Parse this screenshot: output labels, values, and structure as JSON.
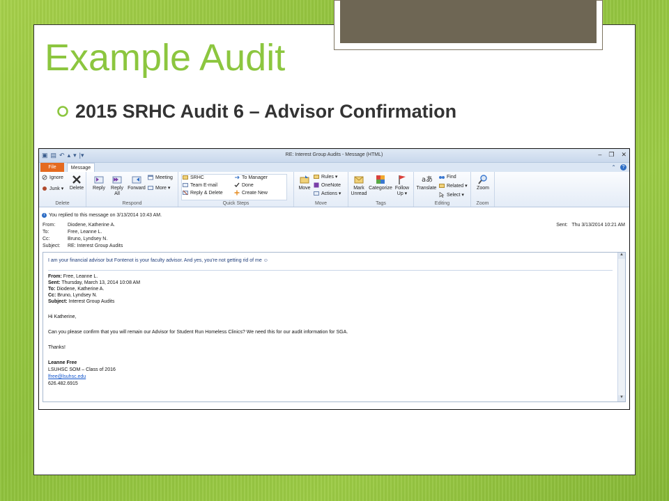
{
  "slide": {
    "title": "Example Audit",
    "bullet": "2015 SRHC Audit 6 – Advisor Confirmation"
  },
  "window": {
    "title": "RE: Interest Group Audits  -  Message (HTML)",
    "tabs": {
      "file": "File",
      "message": "Message"
    }
  },
  "ribbon": {
    "delete_group": {
      "label": "Delete",
      "ignore": "Ignore",
      "junk": "Junk ▾",
      "delete": "Delete"
    },
    "respond_group": {
      "label": "Respond",
      "reply": "Reply",
      "reply_all_1": "Reply",
      "reply_all_2": "All",
      "forward": "Forward",
      "meeting": "Meeting",
      "more": "More ▾"
    },
    "quick_steps": {
      "label": "Quick Steps",
      "items": [
        "SRHC",
        "Team E-mail",
        "Reply & Delete",
        "To Manager",
        "Done",
        "Create New"
      ]
    },
    "move_group": {
      "label": "Move",
      "move": "Move",
      "rules": "Rules ▾",
      "onenote": "OneNote",
      "actions": "Actions ▾"
    },
    "tags_group": {
      "label": "Tags",
      "mark_unread_1": "Mark",
      "mark_unread_2": "Unread",
      "categorize": "Categorize",
      "follow_up_1": "Follow",
      "follow_up_2": "Up ▾"
    },
    "editing_group": {
      "label": "Editing",
      "translate": "Translate",
      "find": "Find",
      "related": "Related ▾",
      "select": "Select ▾"
    },
    "zoom_group": {
      "label": "Zoom",
      "zoom": "Zoom"
    }
  },
  "headers": {
    "info": "You replied to this message on 3/13/2014 10:43 AM.",
    "from_label": "From:",
    "from": "Diodene, Katherine A.",
    "to_label": "To:",
    "to": "Free, Leanne L.",
    "cc_label": "Cc:",
    "cc": "Bruno, Lyndsey N.",
    "subject_label": "Subject:",
    "subject": "RE: Interest Group Audits",
    "sent_label": "Sent:",
    "sent": "Thu 3/13/2014 10:21 AM"
  },
  "body": {
    "reply": "I am your financial advisor but Fontenot is your faculty advisor.  And yes, you're not getting rid of me ☺",
    "q_from_label": "From:",
    "q_from": " Free, Leanne L.",
    "q_sent_label": "Sent:",
    "q_sent": " Thursday, March 13, 2014 10:08 AM",
    "q_to_label": "To:",
    "q_to": " Diodene, Katherine A.",
    "q_cc_label": "Cc:",
    "q_cc": " Bruno, Lyndsey N.",
    "q_subject_label": "Subject:",
    "q_subject": " Interest Group Audits",
    "greeting": "Hi Katherine,",
    "message": "Can you please confirm that you will remain our Advisor for Student Run Homeless Clinics? We need this for our audit information for SGA.",
    "thanks": "Thanks!",
    "sig_name": "Leanne Free",
    "sig_line": "LSUHSC SOM – Class of 2016",
    "sig_email": "lfree@lsuhsc.edu",
    "sig_phone": "626.482.6915"
  }
}
